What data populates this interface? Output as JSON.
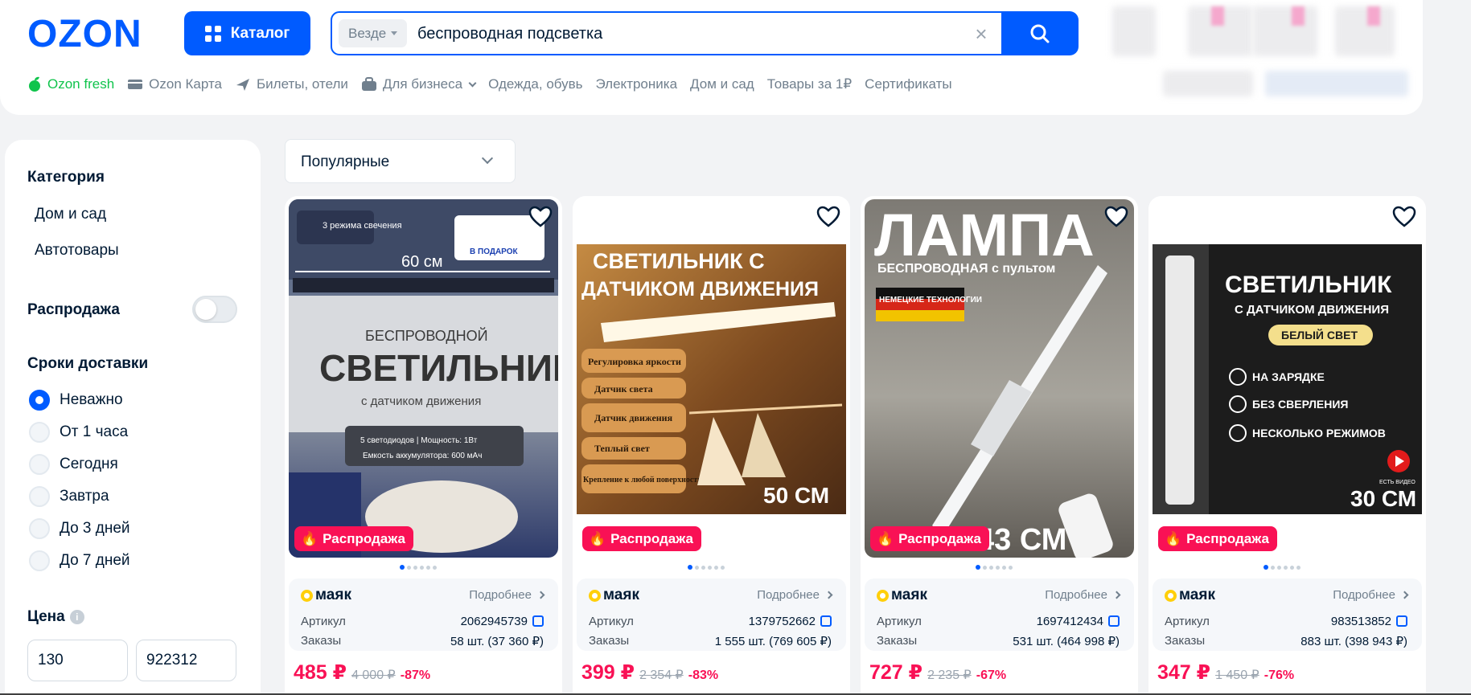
{
  "header": {
    "logo_text": "OZON",
    "catalog_label": "Каталог",
    "search": {
      "scope": "Везде",
      "query": "беспроводная подсветка"
    }
  },
  "nav": [
    {
      "label": "Ozon fresh",
      "icon": "fresh-leaf-icon"
    },
    {
      "label": "Ozon Карта",
      "icon": "card-icon"
    },
    {
      "label": "Билеты, отели",
      "icon": "plane-icon"
    },
    {
      "label": "Для бизнеса",
      "icon": "briefcase-icon"
    },
    {
      "label": "Одежда, обувь"
    },
    {
      "label": "Электроника"
    },
    {
      "label": "Дом и сад"
    },
    {
      "label": "Товары за 1₽"
    },
    {
      "label": "Сертификаты"
    }
  ],
  "sidebar": {
    "category_title": "Категория",
    "categories": [
      "Дом и сад",
      "Автотовары"
    ],
    "sale_label": "Распродажа",
    "sale_enabled": false,
    "delivery_title": "Сроки доставки",
    "delivery_options": [
      "Неважно",
      "От 1 часа",
      "Сегодня",
      "Завтра",
      "До 3 дней",
      "До 7 дней"
    ],
    "delivery_selected": "Неважно",
    "price_title": "Цена",
    "price_min": "130",
    "price_max": "922312"
  },
  "sort": {
    "label": "Популярные"
  },
  "products": [
    {
      "badge": "Распродажа",
      "image": {
        "kind": "panel",
        "top_text": "60 см",
        "line1": "БЕСПРОВОДНОЙ",
        "line2": "СВЕТИЛЬНИК",
        "line3": "с датчиком движения",
        "tag": "3 режима свечения",
        "gift": "В ПОДАРОК",
        "spec1": "5 светодиодов | Мощность: 1Вт",
        "spec2": "Емкость аккумулятора: 600 мАч",
        "bg": "#4c5a74"
      },
      "seller": "маяк",
      "more": "Подробнее",
      "article_label": "Артикул",
      "article": "2062945739",
      "orders_label": "Заказы",
      "orders": "58 шт. (37 360 ₽)",
      "price": "485 ₽",
      "old_price": "4 000 ₽",
      "discount": "-87%"
    },
    {
      "badge": "Распродажа",
      "image": {
        "kind": "warm",
        "line1": "СВЕТИЛЬНИК С",
        "line2": "ДАТЧИКОМ ДВИЖЕНИЯ",
        "features": [
          "Регулировка яркости",
          "Датчик света",
          "Датчик движения",
          "Теплый свет",
          "Крепление к любой поверхности"
        ],
        "size": "50 СМ",
        "bg": "#7a4a22"
      },
      "seller": "маяк",
      "more": "Подробнее",
      "article_label": "Артикул",
      "article": "1379752662",
      "orders_label": "Заказы",
      "orders": "1 555 шт. (769 605 ₽)",
      "price": "399 ₽",
      "old_price": "2 354 ₽",
      "discount": "-83%"
    },
    {
      "badge": "Распродажа",
      "image": {
        "kind": "lamp",
        "line1": "ЛАМПА",
        "line2": "БЕСПРОВОДНАЯ с пультом",
        "tag": "НЕМЕЦКИЕ ТЕХНОЛОГИИ",
        "size": "43 СМ",
        "bg": "#9a9a96"
      },
      "seller": "маяк",
      "more": "Подробнее",
      "article_label": "Артикул",
      "article": "1697412434",
      "orders_label": "Заказы",
      "orders": "531 шт. (464 998 ₽)",
      "price": "727 ₽",
      "old_price": "2 235 ₽",
      "discount": "-67%"
    },
    {
      "badge": "Распродажа",
      "image": {
        "kind": "dark",
        "line1": "СВЕТИЛЬНИК",
        "line2": "С ДАТЧИКОМ ДВИЖЕНИЯ",
        "tag": "БЕЛЫЙ СВЕТ",
        "features": [
          "НА ЗАРЯДКЕ",
          "БЕЗ СВЕРЛЕНИЯ",
          "НЕСКОЛЬКО РЕЖИМОВ"
        ],
        "video": "ЕСТЬ ВИДЕО",
        "size": "30 СМ",
        "bg": "#1e1e1e"
      },
      "seller": "маяк",
      "more": "Подробнее",
      "article_label": "Артикул",
      "article": "983513852",
      "orders_label": "Заказы",
      "orders": "883 шт. (398 943 ₽)",
      "price": "347 ₽",
      "old_price": "1 450 ₽",
      "discount": "-76%"
    }
  ],
  "colors": {
    "brand": "#005bff",
    "sale": "#f91155",
    "fresh": "#10c44c",
    "text": "#001a34",
    "muted": "#707f8d"
  }
}
